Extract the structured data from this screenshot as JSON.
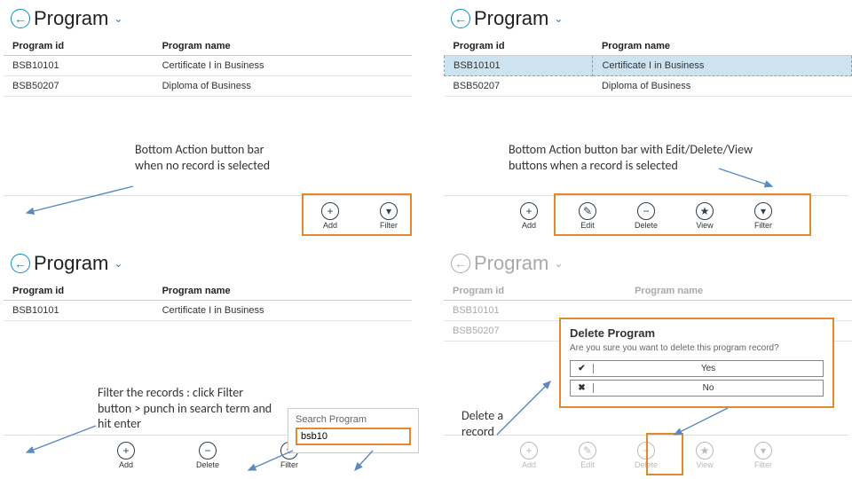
{
  "pageTitle": "Program",
  "cols": {
    "id": "Program id",
    "name": "Program name"
  },
  "rows": [
    {
      "id": "BSB10101",
      "name": "Certificate I in Business"
    },
    {
      "id": "BSB50207",
      "name": "Diploma of Business"
    }
  ],
  "actions": {
    "add": "Add",
    "edit": "Edit",
    "del": "Delete",
    "view": "View",
    "filter": "Filter"
  },
  "annotations": {
    "a1": "Bottom Action button bar when no record is selected",
    "a2": "Bottom Action button bar with Edit/Delete/View buttons when a record is selected",
    "a3": "Filter the records : click Filter button > punch in search term and hit enter",
    "a4": "Delete a record"
  },
  "search": {
    "title": "Search Program",
    "value": "bsb10"
  },
  "dialog": {
    "title": "Delete Program",
    "question": "Are you sure you want to delete this program record?",
    "yes": "Yes",
    "no": "No"
  }
}
